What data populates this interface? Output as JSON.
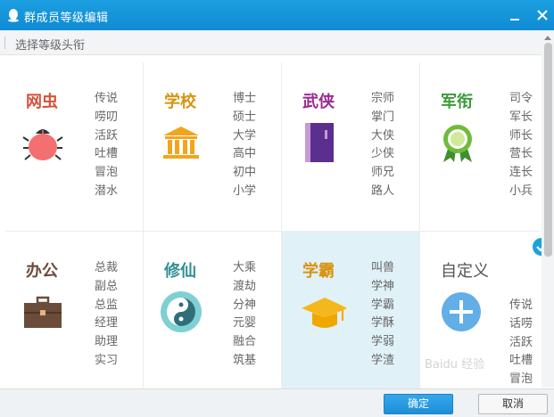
{
  "window": {
    "title": "群成员等级编辑"
  },
  "subheader": {
    "label": "选择等级头衔"
  },
  "colors": {
    "titlebar": "#1295dc",
    "selected_bg": "#e1f1f8",
    "ok_button": "#2a9be2",
    "check": "#1aa2de"
  },
  "cells": [
    {
      "name": "网虫",
      "name_color": "#d4523a",
      "icon": "bug-icon",
      "selected": false,
      "levels": [
        "传说",
        "唠叨",
        "活跃",
        "吐槽",
        "冒泡",
        "潜水"
      ]
    },
    {
      "name": "学校",
      "name_color": "#d89410",
      "icon": "school-building-icon",
      "selected": false,
      "levels": [
        "博士",
        "硕士",
        "大学",
        "高中",
        "初中",
        "小学"
      ]
    },
    {
      "name": "武侠",
      "name_color": "#9a2b8f",
      "icon": "book-icon",
      "selected": false,
      "levels": [
        "宗师",
        "掌门",
        "大侠",
        "少侠",
        "师兄",
        "路人"
      ]
    },
    {
      "name": "军衔",
      "name_color": "#3a9a3a",
      "icon": "medal-icon",
      "selected": false,
      "levels": [
        "司令",
        "军长",
        "师长",
        "营长",
        "连长",
        "小兵"
      ]
    },
    {
      "name": "办公",
      "name_color": "#6b4c3a",
      "icon": "briefcase-icon",
      "selected": false,
      "levels": [
        "总裁",
        "副总",
        "总监",
        "经理",
        "助理",
        "实习"
      ]
    },
    {
      "name": "修仙",
      "name_color": "#2f8f93",
      "icon": "yin-yang-icon",
      "selected": false,
      "levels": [
        "大乘",
        "渡劫",
        "分神",
        "元婴",
        "融合",
        "筑基"
      ]
    },
    {
      "name": "学霸",
      "name_color": "#d89410",
      "icon": "graduation-cap-icon",
      "selected": true,
      "levels": [
        "叫兽",
        "学神",
        "学霸",
        "学酥",
        "学弱",
        "学渣"
      ]
    },
    {
      "name": "自定义",
      "name_color": "#555555",
      "icon": "plus-circle-icon",
      "selected": false,
      "levels": [
        "传说",
        "话唠",
        "活跃",
        "吐槽",
        "冒泡"
      ]
    }
  ],
  "footer": {
    "ok_label": "确定",
    "cancel_label": "取消"
  },
  "watermark": "Baidu 经验"
}
